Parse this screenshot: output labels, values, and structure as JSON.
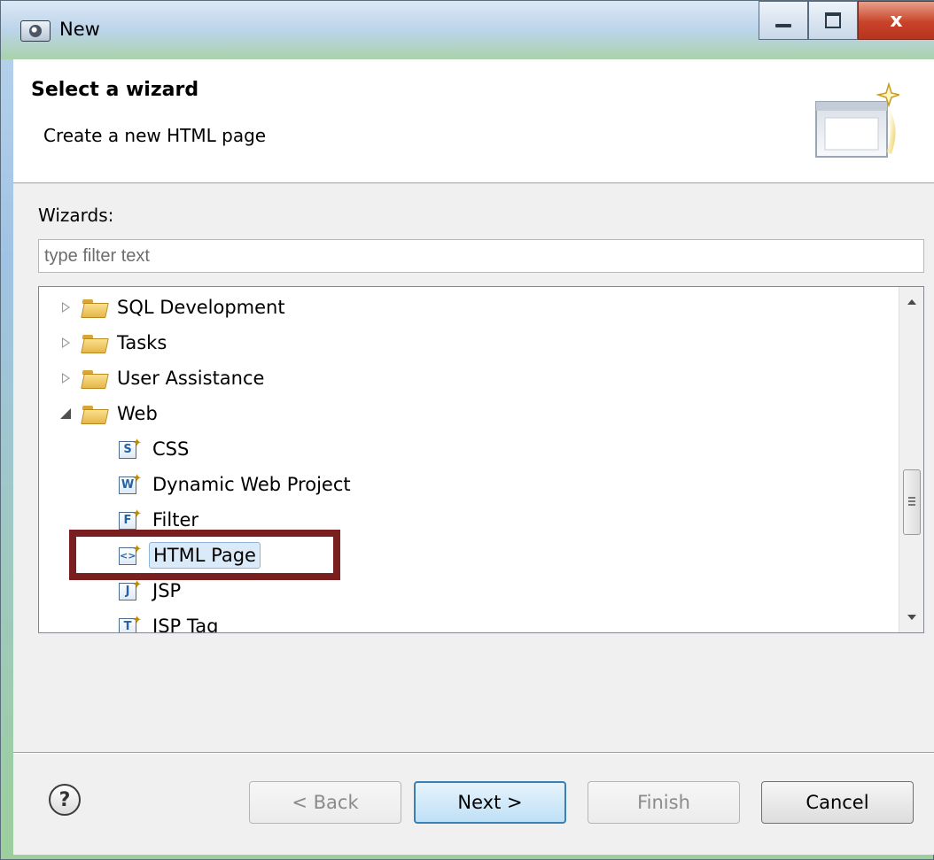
{
  "window": {
    "title": "New",
    "controls": {
      "minimize": "minimize",
      "maximize": "maximize",
      "close": "x"
    }
  },
  "banner": {
    "title": "Select a wizard",
    "description": "Create a new HTML page",
    "graphic_icon": "new-wizard-graphic-icon"
  },
  "wizards": {
    "label": "Wizards:",
    "filter_placeholder": "type filter text",
    "tree": [
      {
        "label": "SQL Development",
        "type": "folder",
        "state": "collapsed"
      },
      {
        "label": "Tasks",
        "type": "folder",
        "state": "collapsed"
      },
      {
        "label": "User Assistance",
        "type": "folder",
        "state": "collapsed"
      },
      {
        "label": "Web",
        "type": "folder",
        "state": "expanded"
      },
      {
        "label": "CSS",
        "type": "item",
        "icon": "css-file-icon",
        "glyph": "S"
      },
      {
        "label": "Dynamic Web Project",
        "type": "item",
        "icon": "web-project-icon",
        "glyph": "W"
      },
      {
        "label": "Filter",
        "type": "item",
        "icon": "filter-icon",
        "glyph": "F"
      },
      {
        "label": "HTML Page",
        "type": "item",
        "icon": "html-file-icon",
        "glyph": "<>",
        "selected": true
      },
      {
        "label": "JSP",
        "type": "item",
        "icon": "jsp-file-icon",
        "glyph": "J"
      },
      {
        "label": "JSP Tag",
        "type": "item",
        "icon": "jsp-tag-icon",
        "glyph": "T"
      }
    ]
  },
  "footer": {
    "help": "?",
    "back": "< Back",
    "next": "Next >",
    "finish": "Finish",
    "cancel": "Cancel"
  },
  "colors": {
    "highlight_box": "#7a1f1f",
    "selection": "#dbeaf8",
    "default_button": "#3c7fb1"
  }
}
